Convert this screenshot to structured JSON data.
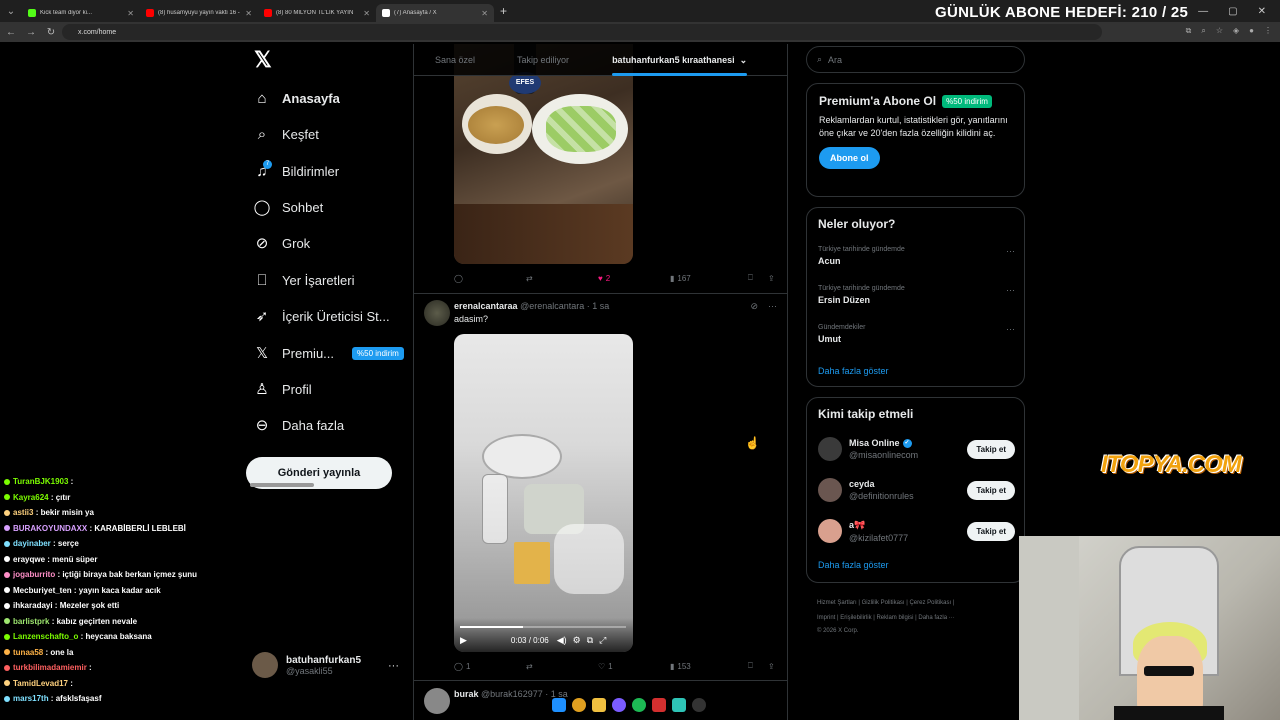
{
  "browser": {
    "tabs": [
      {
        "label": "Kick team diyor ki...",
        "color": "#53fc18"
      },
      {
        "label": "(8) husamyuyu yayın vakti 16 -",
        "color": "#ff0000"
      },
      {
        "label": "(8) 80 MİLYON TL'LİK YAYIN",
        "color": "#ff0000"
      },
      {
        "label": "(7) Anasayfa / X",
        "color": "#ffffff"
      }
    ],
    "url": "x.com/home"
  },
  "stream_overlay": {
    "goal_text": "GÜNLÜK ABONE HEDEFİ: 210 / 25",
    "sponsor": "ITOPYA.COM"
  },
  "x": {
    "nav": [
      {
        "label": "Anasayfa",
        "icon": "home-icon"
      },
      {
        "label": "Keşfet",
        "icon": "search-icon"
      },
      {
        "label": "Bildirimler",
        "icon": "bell-icon",
        "badge": "7"
      },
      {
        "label": "Sohbet",
        "icon": "chat-icon"
      },
      {
        "label": "Grok",
        "icon": "grok-icon"
      },
      {
        "label": "Yer İşaretleri",
        "icon": "bookmark-icon"
      },
      {
        "label": "İçerik Üreticisi St...",
        "icon": "rocket-icon"
      },
      {
        "label": "Premiu...",
        "icon": "x-icon",
        "badge": "%50 indirim"
      },
      {
        "label": "Profil",
        "icon": "person-icon"
      },
      {
        "label": "Daha fazla",
        "icon": "more-icon"
      }
    ],
    "post_button": "Gönderi yayınla",
    "account": {
      "name": "batuhanfurkan5",
      "handle": "@yasakli55"
    },
    "feed_tabs": [
      "Sana özel",
      "Takip ediliyor",
      "batuhanfurkan5 kıraathanesi"
    ],
    "post1": {
      "image_brand": "EFES",
      "likes": "2",
      "views": "167"
    },
    "post2": {
      "name": "erenalcantaraa",
      "handle": "@erenalcantara",
      "time": "· 1 sa",
      "text": "adasim?",
      "video_time": "0:03 / 0:06",
      "replies": "1",
      "likes": "1",
      "views": "153"
    },
    "post3": {
      "name": "burak",
      "handle": "@burak162977",
      "time": "· 1 sa"
    },
    "search_placeholder": "Ara",
    "premium": {
      "title": "Premium'a Abone Ol",
      "badge": "%50 indirim",
      "desc": "Reklamlardan kurtul, istatistikleri gör, yanıtlarını öne çıkar ve 20'den fazla özelliğin kilidini aç.",
      "button": "Abone ol"
    },
    "trends": {
      "title": "Neler oluyor?",
      "items": [
        {
          "context": "Türkiye tarihinde gündemde",
          "name": "Acun"
        },
        {
          "context": "Türkiye tarihinde gündemde",
          "name": "Ersin Düzen"
        },
        {
          "context": "Gündemdekiler",
          "name": "Umut"
        }
      ],
      "more": "Daha fazla göster"
    },
    "who": {
      "title": "Kimi takip etmeli",
      "items": [
        {
          "name": "Misa Online",
          "handle": "@misaonlinecom",
          "verified": true,
          "button": "Takip et"
        },
        {
          "name": "ceyda",
          "handle": "@definitionrules",
          "verified": false,
          "button": "Takip et"
        },
        {
          "name": "a🎀",
          "handle": "@kizilafet0777",
          "verified": false,
          "button": "Takip et"
        }
      ],
      "more": "Daha fazla göster"
    },
    "footer": {
      "line1": "Hizmet Şartları  |  Gizlilik Politikası  |  Çerez Politikası  |",
      "line2": "Imprint  |  Erişilebilirlik  |  Reklam bilgisi  |  Daha fazla ···",
      "line3": "© 2026 X Corp."
    }
  },
  "chat": [
    {
      "user": "TuranBJK1903",
      "msg": "",
      "color": "#7cfc00"
    },
    {
      "user": "Kayra624",
      "msg": "çıtır",
      "color": "#7cfc00"
    },
    {
      "user": "astii3",
      "msg": "bekir misin ya",
      "color": "#ffd27f"
    },
    {
      "user": "BURAKOYUNDAXX",
      "msg": "KARABİBERLİ LEBLEBİ",
      "color": "#d8a0ff"
    },
    {
      "user": "dayinaber",
      "msg": "serçe",
      "color": "#7fe0ff"
    },
    {
      "user": "erayqwe",
      "msg": "menü süper",
      "color": "#ffffff"
    },
    {
      "user": "jogaburrito",
      "msg": "içtiği biraya bak berkan içmez şunu",
      "color": "#ff8fc8"
    },
    {
      "user": "Mecburiyet_ten",
      "msg": "yayın kaca kadar acık",
      "color": "#ffffff"
    },
    {
      "user": "ihkaradayi",
      "msg": "Mezeler şok etti",
      "color": "#ffffff"
    },
    {
      "user": "barlistprk",
      "msg": "kabız geçirten nevale",
      "color": "#9fe870"
    },
    {
      "user": "Lanzenschafto_o",
      "msg": "heycana baksana",
      "color": "#7cfc00"
    },
    {
      "user": "tunaa58",
      "msg": "one la",
      "color": "#ffb347"
    },
    {
      "user": "turkbilimadamiemir",
      "msg": "",
      "color": "#ff6060"
    },
    {
      "user": "TamidLevad17",
      "msg": "",
      "color": "#ffd27f"
    },
    {
      "user": "mars17th",
      "msg": "afsklsfaşasf",
      "color": "#7fe0ff"
    }
  ]
}
